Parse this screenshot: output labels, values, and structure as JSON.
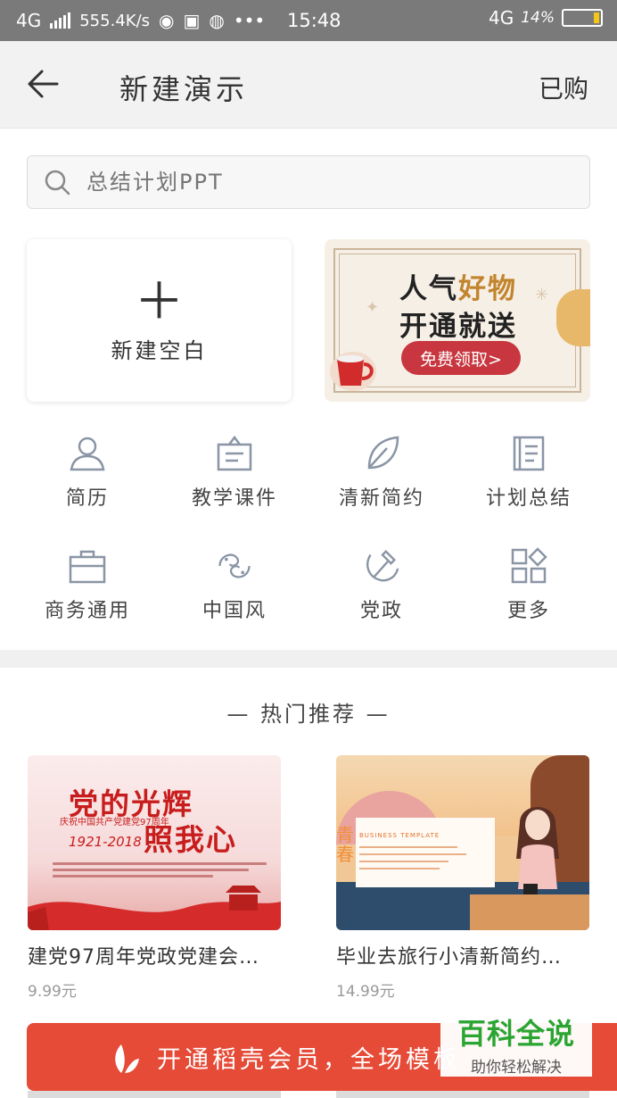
{
  "status_bar": {
    "network_left": "4G",
    "speed": "555.4K/s",
    "time": "15:48",
    "network_right": "4G",
    "battery": "14%",
    "battery_level": 0.14,
    "bg_color": "#7a7a7a"
  },
  "app_bar": {
    "title": "新建演示",
    "right_action": "已购"
  },
  "search": {
    "placeholder": "总结计划PPT"
  },
  "new_blank": {
    "label": "新建空白"
  },
  "banner": {
    "line1_a": "人气",
    "line1_b": "好物",
    "line2": "开通就送",
    "cta": "免费领取>"
  },
  "categories": [
    {
      "label": "简历",
      "icon": "person-icon"
    },
    {
      "label": "教学课件",
      "icon": "easel-icon"
    },
    {
      "label": "清新简约",
      "icon": "leaf-icon"
    },
    {
      "label": "计划总结",
      "icon": "notebook-icon"
    },
    {
      "label": "商务通用",
      "icon": "briefcase-icon"
    },
    {
      "label": "中国风",
      "icon": "fish-icon"
    },
    {
      "label": "党政",
      "icon": "hammer-sickle-icon"
    },
    {
      "label": "更多",
      "icon": "grid-icon"
    }
  ],
  "hot": {
    "title": "— 热门推荐 —",
    "items": [
      {
        "name": "建党97周年党政党建会…",
        "price": "9.99元",
        "thumb_title_a": "党的光辉",
        "thumb_title_b": "照我心",
        "thumb_sub": "庆祝中国共产党建党97周年",
        "thumb_years": "1921-2018"
      },
      {
        "name": "毕业去旅行小清新简约…",
        "price": "14.99元",
        "thumb_label": "BUSINESS TEMPLATE",
        "thumb_vertical": "青春"
      }
    ]
  },
  "member_bar": {
    "text": "开通稻壳会员，全场模板",
    "color": "#e64b37"
  },
  "watermark": {
    "line1": "百科全说",
    "line2": "助你轻松解决"
  }
}
